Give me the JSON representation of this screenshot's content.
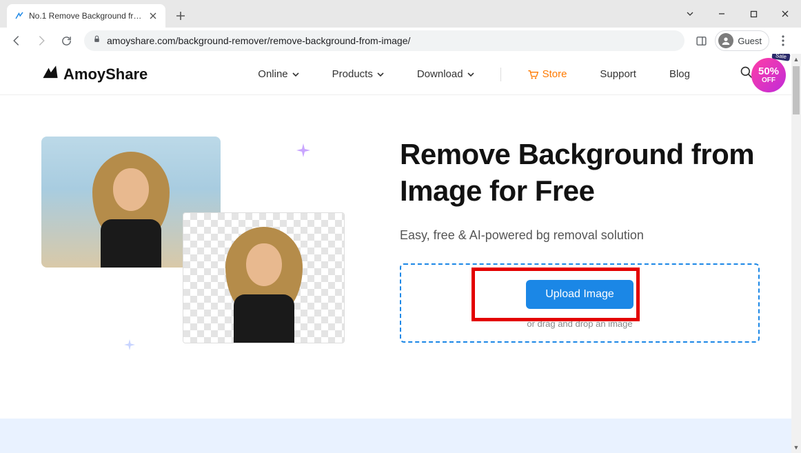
{
  "browser": {
    "tab_title": "No.1 Remove Background from",
    "url": "amoyshare.com/background-remover/remove-background-from-image/",
    "profile_label": "Guest"
  },
  "header": {
    "logo_text": "AmoyShare",
    "nav": {
      "online": "Online",
      "products": "Products",
      "download": "Download",
      "store": "Store",
      "support": "Support",
      "blog": "Blog"
    },
    "sale": {
      "tag": "Sale",
      "percent": "50%",
      "off": "OFF"
    }
  },
  "hero": {
    "headline": "Remove Background from Image for Free",
    "subtitle": "Easy, free & AI-powered bg removal solution",
    "upload_button": "Upload Image",
    "drop_hint": "or drag and drop an image"
  }
}
